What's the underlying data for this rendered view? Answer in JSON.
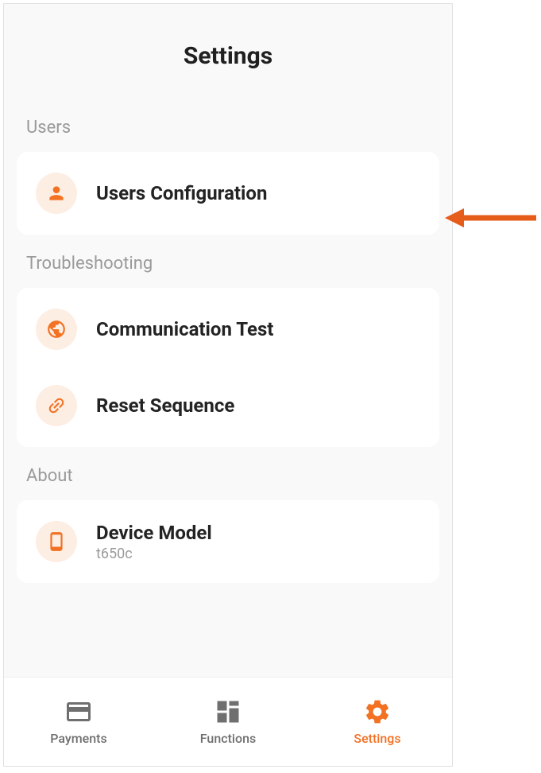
{
  "page": {
    "title": "Settings"
  },
  "sections": {
    "users": {
      "label": "Users",
      "items": [
        {
          "label": "Users Configuration"
        }
      ]
    },
    "troubleshooting": {
      "label": "Troubleshooting",
      "items": [
        {
          "label": "Communication Test"
        },
        {
          "label": "Reset Sequence"
        }
      ]
    },
    "about": {
      "label": "About",
      "items": [
        {
          "label": "Device Model",
          "sub": "t650c"
        }
      ]
    }
  },
  "nav": {
    "payments": "Payments",
    "functions": "Functions",
    "settings": "Settings"
  }
}
